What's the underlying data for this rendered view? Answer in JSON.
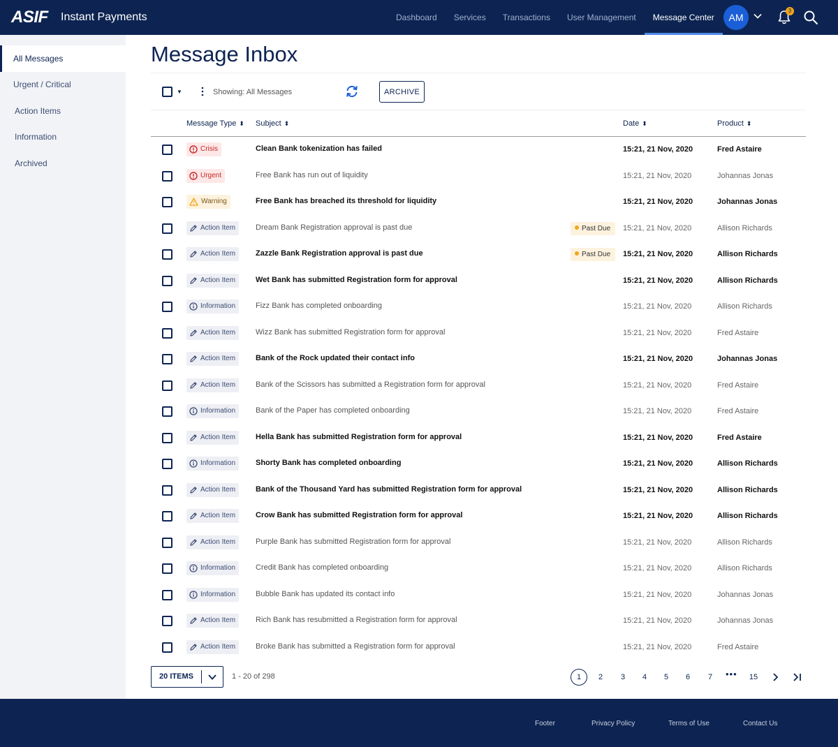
{
  "header": {
    "logo": "ASIF",
    "app_name": "Instant Payments",
    "nav": [
      "Dashboard",
      "Services",
      "Transactions",
      "User Management",
      "Message Center"
    ],
    "active_nav": "Message Center",
    "avatar_initials": "AM",
    "notification_count": "3"
  },
  "sidebar": {
    "items": [
      "All Messages",
      "Urgent / Critical",
      "Action Items",
      "Information",
      "Archived"
    ],
    "active": "All Messages"
  },
  "main": {
    "title": "Message Inbox",
    "showing": "Showing: All Messages",
    "archive_label": "ARCHIVE",
    "columns": {
      "type": "Message Type",
      "subject": "Subject",
      "date": "Date",
      "product": "Product"
    },
    "rows": [
      {
        "type": "Crisis",
        "subject": "Clean Bank tokenization has failed",
        "date": "15:21, 21 Nov, 2020",
        "product": "Fred Astaire",
        "unread": true
      },
      {
        "type": "Urgent",
        "subject": "Free Bank has run out of liquidity",
        "date": "15:21, 21 Nov, 2020",
        "product": "Johannas Jonas",
        "unread": false
      },
      {
        "type": "Warning",
        "subject": "Free Bank has breached its threshold for liquidity",
        "date": "15:21, 21 Nov, 2020",
        "product": "Johannas Jonas",
        "unread": true
      },
      {
        "type": "Action Item",
        "subject": "Dream Bank Registration approval is past due",
        "badge": "Past Due",
        "date": "15:21, 21 Nov, 2020",
        "product": "Allison Richards",
        "unread": false
      },
      {
        "type": "Action Item",
        "subject": "Zazzle Bank Registration approval is past due",
        "badge": "Past Due",
        "date": "15:21, 21 Nov, 2020",
        "product": "Allison Richards",
        "unread": true
      },
      {
        "type": "Action Item",
        "subject": "Wet Bank has submitted Registration form for approval",
        "date": "15:21, 21 Nov, 2020",
        "product": "Allison Richards",
        "unread": true
      },
      {
        "type": "Information",
        "subject": "Fizz Bank has completed onboarding",
        "date": "15:21, 21 Nov, 2020",
        "product": "Allison Richards",
        "unread": false
      },
      {
        "type": "Action Item",
        "subject": "Wizz Bank has submitted Registration form for approval",
        "date": "15:21, 21 Nov, 2020",
        "product": "Fred Astaire",
        "unread": false
      },
      {
        "type": "Action Item",
        "subject": "Bank of the Rock updated their contact info",
        "date": "15:21, 21 Nov, 2020",
        "product": "Johannas Jonas",
        "unread": true
      },
      {
        "type": "Action Item",
        "subject": "Bank of the Scissors has submitted a Registration form for approval",
        "date": "15:21, 21 Nov, 2020",
        "product": "Fred Astaire",
        "unread": false
      },
      {
        "type": "Information",
        "subject": "Bank of the Paper has completed onboarding",
        "date": "15:21, 21 Nov, 2020",
        "product": "Fred Astaire",
        "unread": false
      },
      {
        "type": "Action Item",
        "subject": "Hella Bank has submitted Registration form for approval",
        "date": "15:21, 21 Nov, 2020",
        "product": "Fred Astaire",
        "unread": true
      },
      {
        "type": "Information",
        "subject": "Shorty Bank has completed onboarding",
        "date": "15:21, 21 Nov, 2020",
        "product": "Allison Richards",
        "unread": true
      },
      {
        "type": "Action Item",
        "subject": "Bank of the Thousand Yard has submitted Registration form for approval",
        "date": "15:21, 21 Nov, 2020",
        "product": "Allison Richards",
        "unread": true
      },
      {
        "type": "Action Item",
        "subject": "Crow Bank has submitted Registration form for approval",
        "date": "15:21, 21 Nov, 2020",
        "product": "Allison Richards",
        "unread": true
      },
      {
        "type": "Action Item",
        "subject": "Purple Bank has submitted Registration form for approval",
        "date": "15:21, 21 Nov, 2020",
        "product": "Allison Richards",
        "unread": false
      },
      {
        "type": "Information",
        "subject": "Credit Bank has completed onboarding",
        "date": "15:21, 21 Nov, 2020",
        "product": "Allison Richards",
        "unread": false
      },
      {
        "type": "Information",
        "subject": "Bubble Bank has updated its contact info",
        "date": "15:21, 21 Nov, 2020",
        "product": "Johannas Jonas",
        "unread": false
      },
      {
        "type": "Action Item",
        "subject": "Rich Bank has resubmitted a Registration form for approval",
        "date": "15:21, 21 Nov, 2020",
        "product": "Johannas Jonas",
        "unread": false
      },
      {
        "type": "Action Item",
        "subject": "Broke Bank has submitted a Registration form for approval",
        "date": "15:21, 21 Nov, 2020",
        "product": "Fred Astaire",
        "unread": false
      }
    ]
  },
  "pagination": {
    "page_size": "20 ITEMS",
    "range": "1 - 20 of 298",
    "pages": [
      "1",
      "2",
      "3",
      "4",
      "5",
      "6",
      "7"
    ],
    "current": "1",
    "ellipsis": "•••",
    "last_page": "15"
  },
  "footer": {
    "links": [
      "Footer",
      "Privacy Policy",
      "Terms of Use",
      "Contact Us"
    ]
  },
  "colors": {
    "navy": "#0d2452",
    "accent": "#1b5fd8",
    "crisis": "#c62828",
    "warning": "#f2a51a"
  }
}
